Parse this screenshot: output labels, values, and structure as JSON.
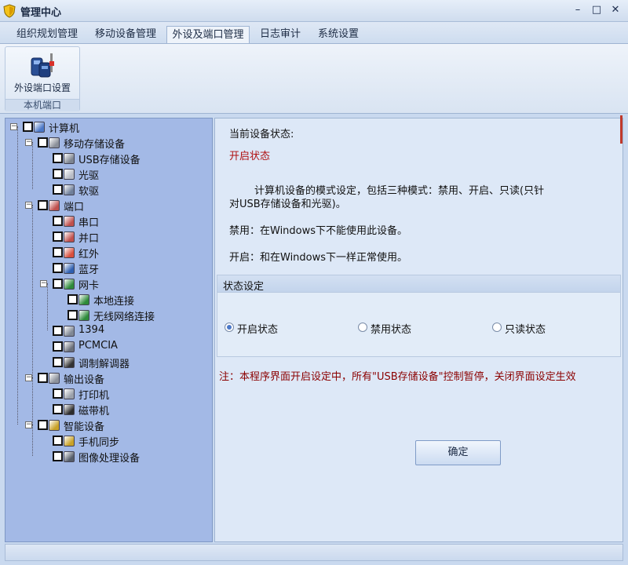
{
  "window": {
    "title": "管理中心",
    "controls": {
      "minimize": "–",
      "maximize": "□",
      "close": "✕"
    }
  },
  "tabs": [
    {
      "label": "组织规划管理",
      "active": false
    },
    {
      "label": "移动设备管理",
      "active": false
    },
    {
      "label": "外设及端口管理",
      "active": true
    },
    {
      "label": "日志审计",
      "active": false
    },
    {
      "label": "系统设置",
      "active": false
    }
  ],
  "ribbon": {
    "button_label": "外设端口设置",
    "button_icon": "port-settings-icon",
    "group_label": "本机端口"
  },
  "tree": [
    {
      "label": "计算机",
      "icon": "computer-icon",
      "expander": "−"
    },
    {
      "label": "移动存储设备",
      "icon": "storage-icon",
      "expander": "−"
    },
    {
      "label": "USB存储设备",
      "icon": "usb-icon"
    },
    {
      "label": "光驱",
      "icon": "cdrom-icon"
    },
    {
      "label": "软驱",
      "icon": "floppy-icon"
    },
    {
      "label": "端口",
      "icon": "port-icon",
      "expander": "−"
    },
    {
      "label": "串口",
      "icon": "serial-port-icon"
    },
    {
      "label": "并口",
      "icon": "parallel-port-icon"
    },
    {
      "label": "红外",
      "icon": "infrared-icon"
    },
    {
      "label": "蓝牙",
      "icon": "bluetooth-icon"
    },
    {
      "label": "网卡",
      "icon": "network-card-icon",
      "expander": "−"
    },
    {
      "label": "本地连接",
      "icon": "local-connection-icon"
    },
    {
      "label": "无线网络连接",
      "icon": "wireless-connection-icon"
    },
    {
      "label": "1394",
      "icon": "firewire-icon"
    },
    {
      "label": "PCMCIA",
      "icon": "pcmcia-icon"
    },
    {
      "label": "调制解调器",
      "icon": "modem-icon"
    },
    {
      "label": "输出设备",
      "icon": "output-device-icon",
      "expander": "−"
    },
    {
      "label": "打印机",
      "icon": "printer-icon"
    },
    {
      "label": "磁带机",
      "icon": "tape-drive-icon"
    },
    {
      "label": "智能设备",
      "icon": "smart-device-icon",
      "expander": "−"
    },
    {
      "label": "手机同步",
      "icon": "phone-sync-icon"
    },
    {
      "label": "图像处理设备",
      "icon": "imaging-device-icon"
    }
  ],
  "content": {
    "current_status_label": "当前设备状态:",
    "current_status_value": "开启状态",
    "description_line1": "计算机设备的模式设定，包括三种模式：禁用、开启、只读(只针",
    "description_line2": "对USB存储设备和光驱)。",
    "disable_note": "禁用：在Windows下不能使用此设备。",
    "enable_note": "开启：和在Windows下一样正常使用。",
    "status_group_title": "状态设定",
    "radios": [
      {
        "label": "开启状态",
        "checked": true
      },
      {
        "label": "禁用状态",
        "checked": false
      },
      {
        "label": "只读状态",
        "checked": false
      }
    ],
    "warning": "注：本程序界面开启设定中，所有\"USB存储设备\"控制暂停，关闭界面设定生效",
    "confirm_label": "确定"
  },
  "colors": {
    "status_value": "#b01010",
    "warning": "#8b0000",
    "tree_bg": "#a3b9e6",
    "content_bg": "#dde8f7"
  }
}
